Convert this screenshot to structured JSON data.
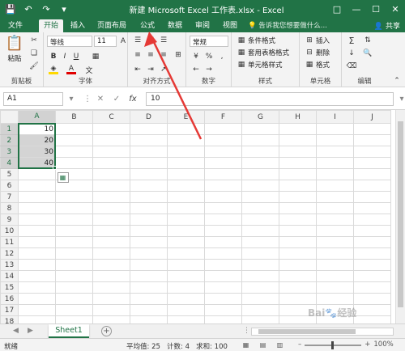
{
  "app": {
    "title": "新建 Microsoft Excel 工作表.xlsx - Excel",
    "accent": "#217346",
    "annotation_color": "#e53935"
  },
  "window_controls": [
    "restore-icon",
    "minimize-icon",
    "maximize-icon",
    "close-icon"
  ],
  "ribbon": {
    "tabs": [
      "文件",
      "开始",
      "插入",
      "页面布局",
      "公式",
      "数据",
      "审阅",
      "视图"
    ],
    "active_tab": "开始",
    "tell_me": "告诉我您想要做什么...",
    "share": "共享",
    "clipboard": {
      "paste": "粘贴",
      "label": "剪贴板"
    },
    "font": {
      "name": "等线",
      "size": "11",
      "label": "字体"
    },
    "alignment": {
      "label": "对齐方式"
    },
    "number": {
      "format": "常规",
      "label": "数字",
      "percent": "%"
    },
    "styles": {
      "conditional": "条件格式",
      "table": "套用表格格式",
      "cell_styles": "单元格样式",
      "label": "样式"
    },
    "cells": {
      "insert": "插入",
      "delete": "删除",
      "format": "格式",
      "label": "单元格"
    },
    "editing": {
      "label": "编辑"
    }
  },
  "formula_bar": {
    "name_box": "A1",
    "fx": "fx",
    "value": "10"
  },
  "grid": {
    "columns": [
      "A",
      "B",
      "C",
      "D",
      "E",
      "F",
      "G",
      "H",
      "I",
      "J"
    ],
    "rows": [
      "1",
      "2",
      "3",
      "4",
      "5",
      "6",
      "7",
      "8",
      "9",
      "10",
      "11",
      "12",
      "13",
      "14",
      "15",
      "16",
      "17",
      "18"
    ],
    "cells": {
      "A1": "10",
      "A2": "20",
      "A3": "30",
      "A4": "40"
    },
    "selection": "A1:A4"
  },
  "sheets": {
    "tabs": [
      "Sheet1"
    ],
    "active": "Sheet1"
  },
  "status": {
    "mode": "就绪",
    "average": "平均值: 25",
    "count": "计数: 4",
    "sum": "求和: 100",
    "zoom": "100%"
  },
  "watermark": "Baidu 经验"
}
